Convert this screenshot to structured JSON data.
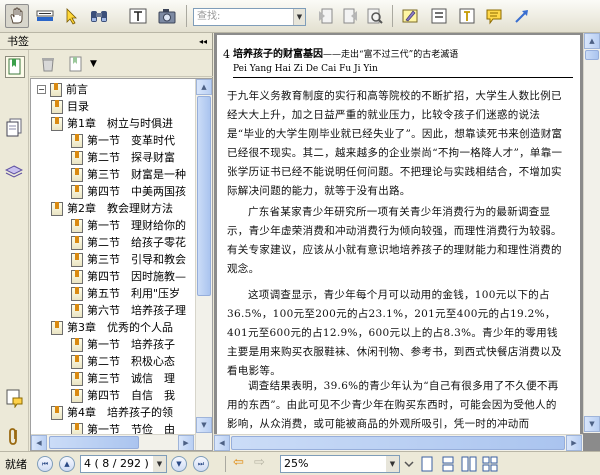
{
  "toolbar": {
    "search_placeholder": "查找:",
    "icons": [
      "hand-tool-icon",
      "text-select-icon",
      "select-arrow-icon",
      "find-binoculars-icon",
      "text-tool-icon",
      "snapshot-icon",
      "search-dropdown-icon",
      "prev-result-icon",
      "next-result-icon",
      "search-web-icon",
      "highlight-icon",
      "text-box-icon",
      "note-icon",
      "arrow-annotation-icon"
    ]
  },
  "sidebar": {
    "title": "书签",
    "collapse_glyph": "◂◂",
    "panel_icons": [
      "bookmarks-panel-icon",
      "pages-panel-icon",
      "layers-panel-icon",
      "comments-panel-icon",
      "attachments-panel-icon"
    ],
    "tools": [
      "delete-bookmark-icon",
      "new-bookmark-icon",
      "bookmark-options-icon"
    ],
    "tree": [
      {
        "label": "前言",
        "level": 0,
        "toggle": "−"
      },
      {
        "label": "目录",
        "level": 1
      },
      {
        "label": "第1章　树立与时俱进",
        "level": 1
      },
      {
        "label": "第一节　变革时代",
        "level": 2
      },
      {
        "label": "第二节　探寻财富",
        "level": 2
      },
      {
        "label": "第三节　财富是一种",
        "level": 2
      },
      {
        "label": "第四节　中美两国孩",
        "level": 2
      },
      {
        "label": "第2章　教会理财方法",
        "level": 1
      },
      {
        "label": "第一节　理财给你的",
        "level": 2
      },
      {
        "label": "第二节　给孩子零花",
        "level": 2
      },
      {
        "label": "第三节　引导和教会",
        "level": 2
      },
      {
        "label": "第四节　因时施教—",
        "level": 2
      },
      {
        "label": "第五节　利用\"压岁",
        "level": 2
      },
      {
        "label": "第六节　培养孩子理",
        "level": 2
      },
      {
        "label": "第3章　优秀的个人品",
        "level": 1
      },
      {
        "label": "第一节　培养孩子",
        "level": 2
      },
      {
        "label": "第二节　积极心态",
        "level": 2
      },
      {
        "label": "第三节　诚信　理",
        "level": 2
      },
      {
        "label": "第四节　自信　我",
        "level": 2
      },
      {
        "label": "第4章　培养孩子的领",
        "level": 1
      },
      {
        "label": "第一节　节俭　由",
        "level": 2
      }
    ]
  },
  "document": {
    "page_number": "4",
    "header_title": "培养孩子的财富基因",
    "header_subtitle": "——走出“富不过三代”的古老滅语",
    "header_pinyin": "Pei Yang Hai Zi De Cai Fu Ji Yin",
    "paragraphs": [
      "于九年义务教育制度的实行和高等院校的不断扩招，大学生人数比例已经大大上升，加之日益严重的就业压力，比较令孩子们迷惑的说法是“毕业的大学生刚毕业就已经失业了”。因此，想靠读死书来创造财富已经很不现实。其二，越来越多的企业崇尚“不拘一格降人才”，单靠一张学历证书已经不能说明任何问题。不把理论与实践相结合，不增加实际解决问题的能力，就等于没有出路。",
      "广东省某家青少年研究所一项有关青少年消费行为的最新调查显示，青少年虚荣消费和冲动消费行为倾向较强，而理性消费行为较弱。有关专家建议，应该从小就有意识地培养孩子的理财能力和理性消费的观念。",
      "这项调查显示，青少年每个月可以动用的金钱，100元以下的占36.5%，100元至200元的占23.1%，201元至400元的占19.2%，401元至600元的占12.9%，600元以上的占8.3%。青少年的零用钱主要是用来购买衣服鞋袜、休闲刊物、参考书，到西式快餐店消费以及看电影等。",
      "调查结果表明，39.6%的青少年认为“自己有很多用了不久便不再用的东西”。由此可见不少青少年在购买东西时，可能会因为受他人的影响，从众消费，或可能被商品的外观所吸引，凭一时的冲动而"
    ]
  },
  "statusbar": {
    "mode_label": "就绪",
    "page_field": "4 ( 8 / 292 )",
    "zoom_field": "25%",
    "nav_icons": [
      "first-page-icon",
      "prev-page-icon",
      "next-page-icon",
      "last-page-icon",
      "back-icon",
      "forward-icon"
    ],
    "view_icons": [
      "single-page-icon",
      "continuous-icon",
      "facing-icon",
      "continuous-facing-icon"
    ]
  }
}
